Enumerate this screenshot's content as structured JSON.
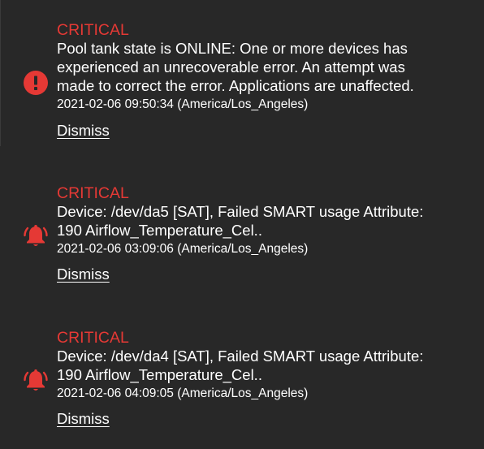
{
  "colors": {
    "background": "#282828",
    "critical": "#e53935",
    "text": "#ffffff"
  },
  "alerts": [
    {
      "icon": "error-circle-icon",
      "level": "CRITICAL",
      "message_lines": [
        "Pool tank state is ONLINE: One or more devices has",
        "experienced an unrecoverable error. An attempt was",
        "made to correct the error. Applications are unaffected."
      ],
      "timestamp": "2021-02-06 09:50:34 (America/Los_Angeles)",
      "dismiss_label": "Dismiss"
    },
    {
      "icon": "bell-icon",
      "level": "CRITICAL",
      "message_lines": [
        "Device: /dev/da5 [SAT], Failed SMART usage Attribute:",
        "190 Airflow_Temperature_Cel.."
      ],
      "timestamp": "2021-02-06 03:09:06 (America/Los_Angeles)",
      "dismiss_label": "Dismiss"
    },
    {
      "icon": "bell-icon",
      "level": "CRITICAL",
      "message_lines": [
        "Device: /dev/da4 [SAT], Failed SMART usage Attribute:",
        "190 Airflow_Temperature_Cel.."
      ],
      "timestamp": "2021-02-06 04:09:05 (America/Los_Angeles)",
      "dismiss_label": "Dismiss"
    }
  ]
}
